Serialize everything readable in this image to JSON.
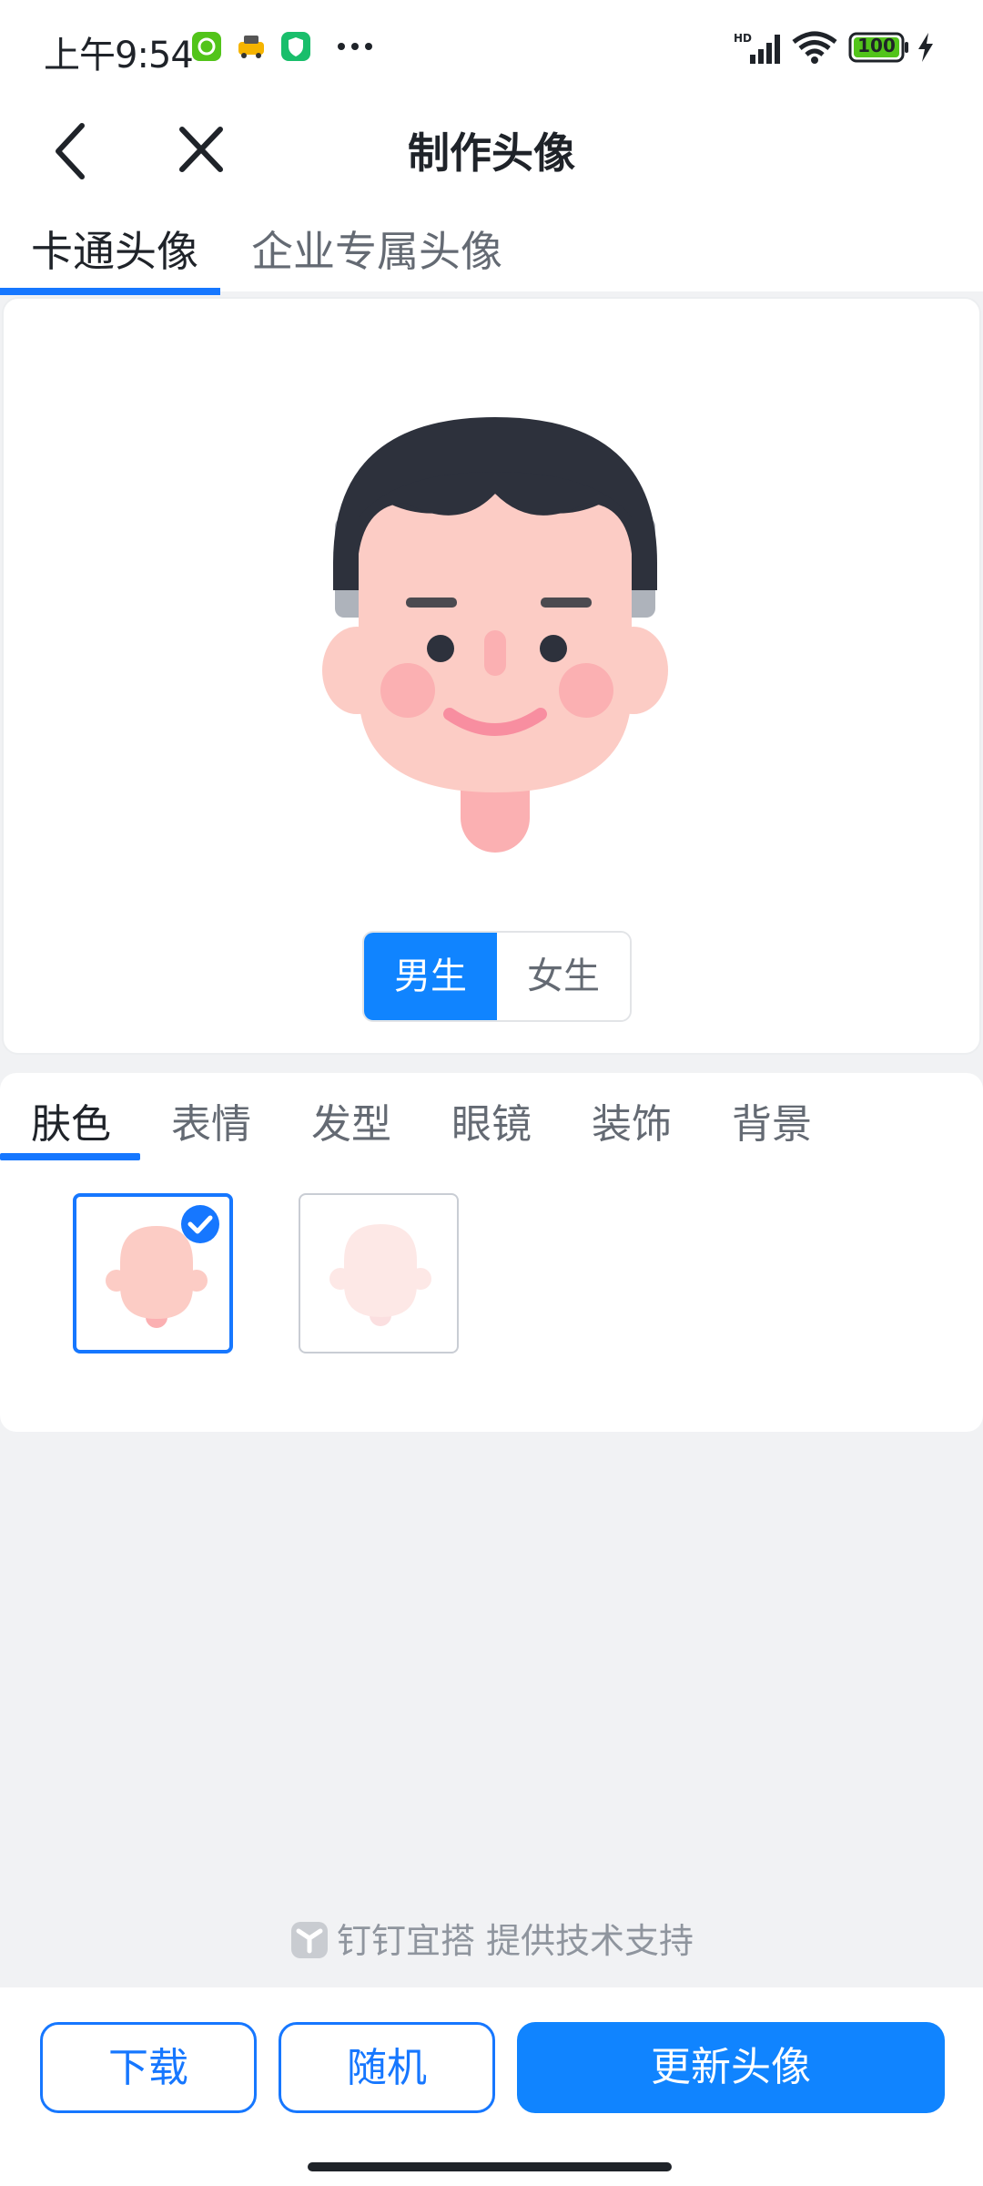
{
  "status_bar": {
    "time": "上午9:54",
    "battery": "100",
    "icons": [
      "app-badge-icon",
      "taxi-icon",
      "shield-app-icon",
      "more-dots-icon",
      "hd-signal-icon",
      "wifi-icon",
      "battery-icon",
      "charging-icon"
    ]
  },
  "nav": {
    "title": "制作头像",
    "back_icon": "chevron-left-icon",
    "close_icon": "close-icon"
  },
  "top_tabs": [
    {
      "label": "卡通头像",
      "active": true
    },
    {
      "label": "企业专属头像",
      "active": false
    }
  ],
  "avatar": {
    "gender_options": [
      {
        "label": "男生",
        "active": true
      },
      {
        "label": "女生",
        "active": false
      }
    ]
  },
  "option_tabs": [
    {
      "label": "肤色",
      "active": true
    },
    {
      "label": "表情",
      "active": false
    },
    {
      "label": "发型",
      "active": false
    },
    {
      "label": "眼镜",
      "active": false
    },
    {
      "label": "装饰",
      "active": false
    },
    {
      "label": "背景",
      "active": false
    }
  ],
  "skin_swatches": [
    {
      "color": "#fcccc5",
      "selected": true
    },
    {
      "color": "#fde8e6",
      "selected": false
    }
  ],
  "credit": {
    "text": "钉钉宜搭 提供技术支持"
  },
  "actions": {
    "download": "下载",
    "random": "随机",
    "update": "更新头像"
  },
  "colors": {
    "accent": "#1677ff",
    "hair": "#2d313c",
    "skin": "#fcccc5",
    "cheek": "#fbb0b2"
  }
}
